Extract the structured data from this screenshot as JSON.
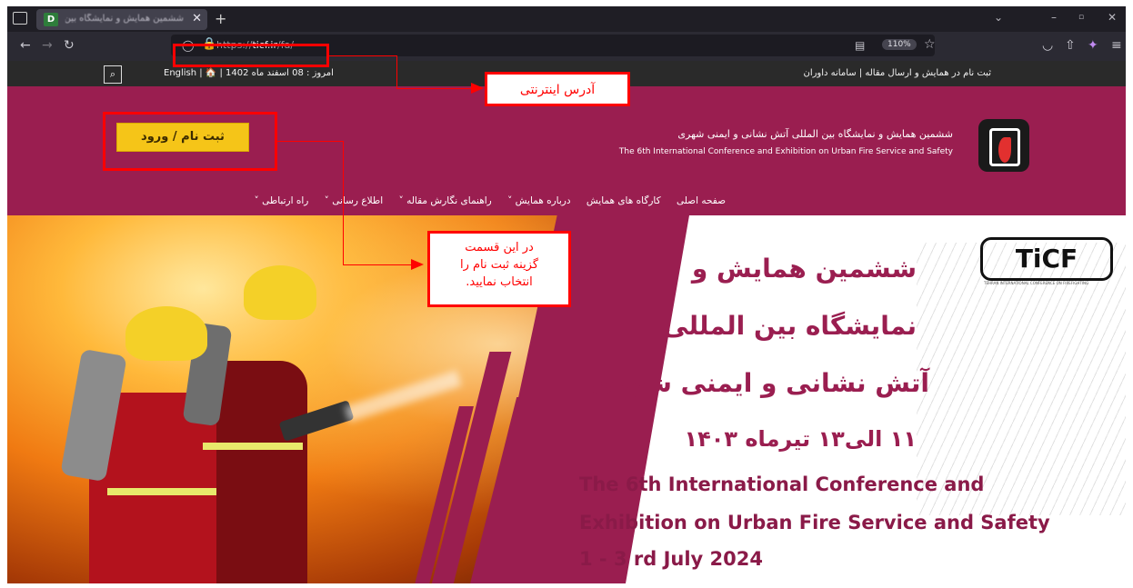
{
  "browser": {
    "tab_title": "ششمین همایش و نمایشگاه بین",
    "tab_favicon": "D",
    "url_prefix": "https://",
    "url_domain": "ticf.ir",
    "url_path": "/fa/",
    "zoom": "110%",
    "icons": [
      "sidebar-icon",
      "back-icon",
      "forward-icon",
      "reload-icon",
      "shield-icon",
      "lock-icon",
      "reader-view-icon",
      "star-icon",
      "pocket-icon",
      "extensions-icon",
      "menu-icon"
    ]
  },
  "topbar": {
    "left_text": "امروز : 08 اسفند ماه 1402  |  🏠  |  English",
    "right_text": "ثبت نام در همایش و ارسال مقاله   |   سامانه داوران"
  },
  "header": {
    "login_label": "ثبت نام / ورود",
    "title_fa": "ششمین همایش و نمایشگاه بین المللی آتش نشانی و ایمنی شهری",
    "title_en": "The 6th International Conference and Exhibition on Urban Fire Service and Safety",
    "menu": [
      "صفحه اصلی",
      "کارگاه های همایش",
      "درباره همایش ˅",
      "راهنمای نگارش مقاله ˅",
      "اطلاع رسانی ˅",
      "راه ارتباطی ˅"
    ]
  },
  "hero": {
    "logo_text": "TiCF",
    "logo_sub": "TEHRAN INTERNATIONAL CONFERENCE ON FIREFIGHTING",
    "fa_line1": "ششمین همایش و",
    "fa_line2": "نمایشگاه بین المللی",
    "fa_line3": "آتش نشانی و ایمنی شهری",
    "fa_line4": "۱۱ الی۱۳ تیرماه ۱۴۰۳",
    "en_line1": "The 6th International Conference and",
    "en_line2": "Exhibition  on Urban Fire Service and Safety",
    "en_line3": "1 - 3 rd July 2024"
  },
  "annotations": {
    "address_label": "آدرس اینترنتی",
    "signup_hint_line1": "در این قسمت",
    "signup_hint_line2": "گزینه ثبت نام را",
    "signup_hint_line3": "انتخاب نمایید."
  },
  "colors": {
    "maroon": "#9a1e50",
    "yellow": "#f5c518",
    "annotation_red": "#ff0000"
  }
}
